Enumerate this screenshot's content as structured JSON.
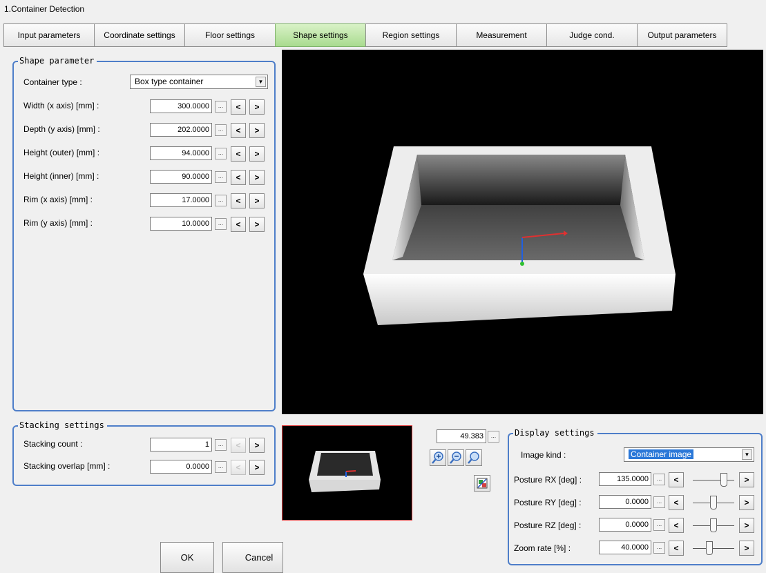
{
  "window": {
    "title": "1.Container Detection"
  },
  "tabs": [
    {
      "label": "Input parameters",
      "active": false
    },
    {
      "label": "Coordinate settings",
      "active": false
    },
    {
      "label": "Floor settings",
      "active": false
    },
    {
      "label": "Shape settings",
      "active": true
    },
    {
      "label": "Region settings",
      "active": false
    },
    {
      "label": "Measurement",
      "active": false
    },
    {
      "label": "Judge cond.",
      "active": false
    },
    {
      "label": "Output parameters",
      "active": false
    }
  ],
  "shape": {
    "title": "Shape parameter",
    "container_type_label": "Container type :",
    "container_type_value": "Box type container",
    "rows": [
      {
        "label": "Width (x axis) [mm] :",
        "value": "300.0000"
      },
      {
        "label": "Depth (y axis) [mm] :",
        "value": "202.0000"
      },
      {
        "label": "Height (outer) [mm] :",
        "value": "94.0000"
      },
      {
        "label": "Height (inner) [mm] :",
        "value": "90.0000"
      },
      {
        "label": "Rim (x axis) [mm] :",
        "value": "17.0000"
      },
      {
        "label": "Rim (y axis) [mm] :",
        "value": "10.0000"
      }
    ]
  },
  "stacking": {
    "title": "Stacking settings",
    "count_label": "Stacking count :",
    "count_value": "1",
    "overlap_label": "Stacking overlap [mm] :",
    "overlap_value": "0.0000"
  },
  "common": {
    "dots": "...",
    "dec": "<",
    "inc": ">"
  },
  "viewer": {
    "zoom_value": "49.383"
  },
  "display": {
    "title": "Display settings",
    "image_kind_label": "Image kind :",
    "image_kind_value": "Container image",
    "rows": [
      {
        "label": "Posture RX [deg] :",
        "value": "135.0000",
        "slider": 0.75
      },
      {
        "label": "Posture RY [deg] :",
        "value": "0.0000",
        "slider": 0.5
      },
      {
        "label": "Posture RZ [deg] :",
        "value": "0.0000",
        "slider": 0.5
      },
      {
        "label": "Zoom rate [%] :",
        "value": "40.0000",
        "slider": 0.4
      }
    ]
  },
  "footer": {
    "ok_label": "OK",
    "cancel_label": "Cancel"
  },
  "colors": {
    "accent": "#4e7ec9",
    "active_tab": "#b4e09a",
    "selection": "#2b78d8",
    "preview_border": "#e04040"
  }
}
